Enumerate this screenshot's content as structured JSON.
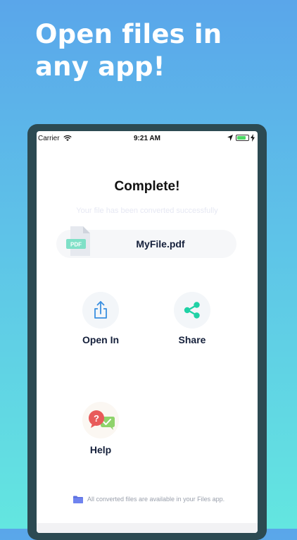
{
  "promo": {
    "headline": "Open files in any app!"
  },
  "statusbar": {
    "carrier": "Carrier",
    "time": "9:21 AM",
    "battery_level": 0.8
  },
  "main": {
    "title": "Complete!",
    "subtitle": "Your file has been converted successfully",
    "file": {
      "name": "MyFile.pdf",
      "type_label": "PDF"
    }
  },
  "actions": {
    "open_in": "Open In",
    "share": "Share",
    "help": "Help"
  },
  "footer": {
    "text": "All converted files are available in your Files app."
  },
  "colors": {
    "accent_blue": "#3a8fe0",
    "share_green": "#1fd1a5",
    "pdf_green": "#7fe0c7",
    "help_red": "#e85a5a",
    "help_green": "#8fd36b",
    "folder": "#5b6fe0"
  },
  "icons": [
    "wifi-icon",
    "location-icon",
    "battery-icon",
    "charging-icon",
    "pdf-file-icon",
    "share-out-icon",
    "share-nodes-icon",
    "help-bubbles-icon",
    "folder-icon"
  ]
}
